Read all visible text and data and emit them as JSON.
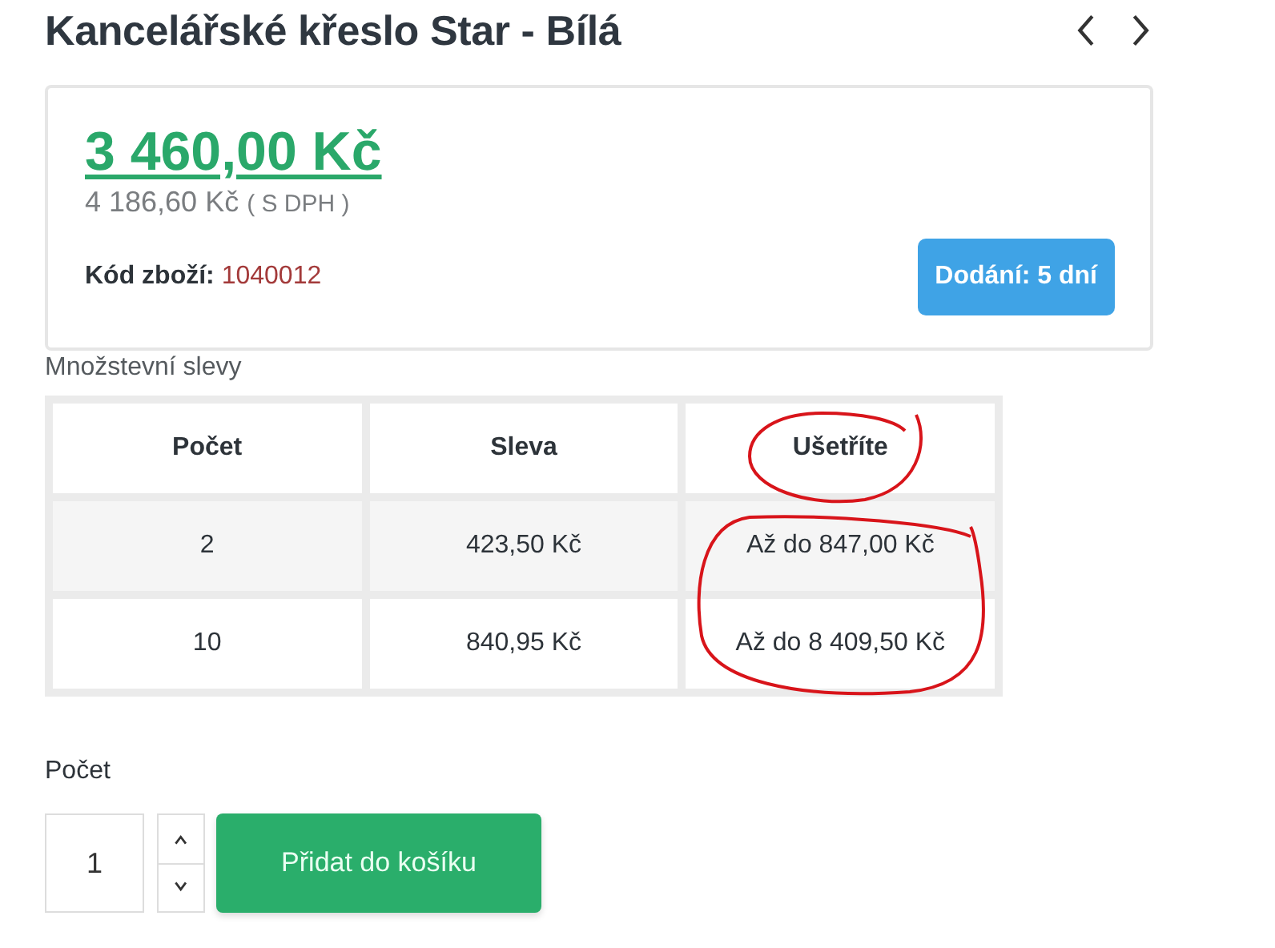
{
  "title": "Kancelářské křeslo Star - Bílá",
  "price": {
    "amount": "3 460,00 Kč",
    "with_vat": "4 186,60 Kč",
    "vat_note": "( S DPH )"
  },
  "product_code": {
    "label": "Kód zboží:",
    "value": "1040012"
  },
  "delivery": "Dodání: 5 dní",
  "discounts": {
    "title": "Množstevní slevy",
    "columns": [
      "Počet",
      "Sleva",
      "Ušetříte"
    ],
    "rows": [
      [
        "2",
        "423,50 Kč",
        "Až do 847,00 Kč"
      ],
      [
        "10",
        "840,95 Kč",
        "Až do 8 409,50 Kč"
      ]
    ]
  },
  "quantity": {
    "label": "Počet",
    "value": "1"
  },
  "add_button": "Přidat do košíku"
}
